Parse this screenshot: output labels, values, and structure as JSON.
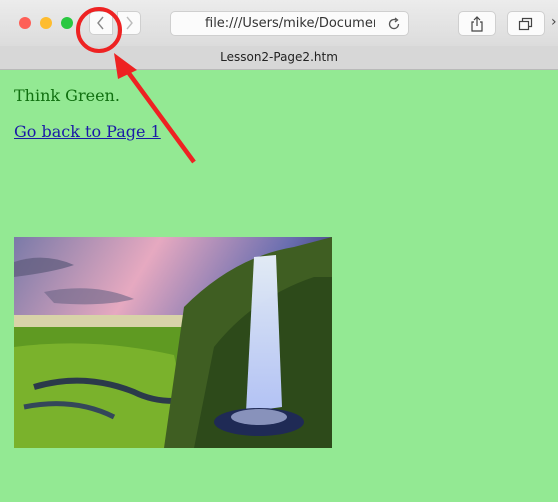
{
  "browser": {
    "url": "file:///Users/mike/Document",
    "tab_title": "Lesson2-Page2.htm",
    "icons": [
      "back-icon",
      "forward-icon",
      "reload-icon",
      "share-icon",
      "tabs-icon"
    ]
  },
  "page": {
    "heading": "Think Green.",
    "back_link": "Go back to Page 1",
    "background": "#93e993"
  },
  "annotation": {
    "color": "#ee2222",
    "items": [
      "circle-highlight",
      "arrow"
    ]
  }
}
